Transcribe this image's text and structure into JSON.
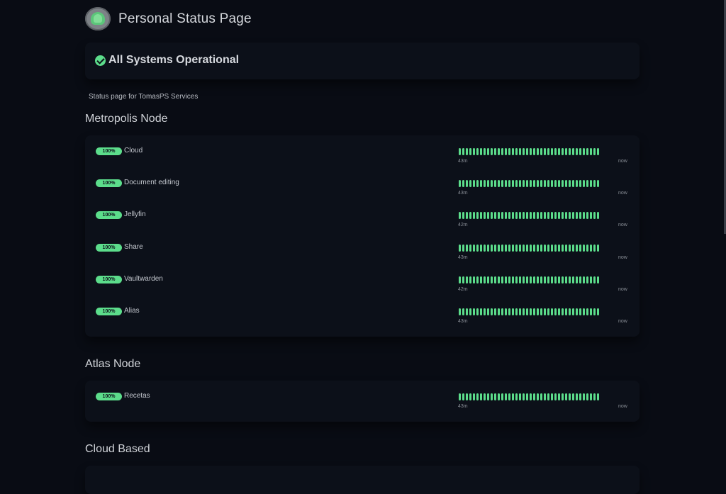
{
  "header": {
    "title": "Personal Status Page",
    "logo_icon": "status-page-logo"
  },
  "overall_status": {
    "text": "All Systems Operational",
    "icon": "check-circle-icon",
    "color": "#5cdd8b"
  },
  "description": "Status page for TomasPS Services",
  "colors": {
    "background": "#090c14",
    "card": "#0c1019",
    "up": "#5cdd8b"
  },
  "groups": [
    {
      "name": "Metropolis Node",
      "monitors": [
        {
          "badge": "100%",
          "name": "Cloud",
          "since": "43m",
          "until": "now",
          "beats_up": 40
        },
        {
          "badge": "100%",
          "name": "Document editing",
          "since": "43m",
          "until": "now",
          "beats_up": 40
        },
        {
          "badge": "100%",
          "name": "Jellyfin",
          "since": "42m",
          "until": "now",
          "beats_up": 40
        },
        {
          "badge": "100%",
          "name": "Share",
          "since": "43m",
          "until": "now",
          "beats_up": 40
        },
        {
          "badge": "100%",
          "name": "Vaultwarden",
          "since": "42m",
          "until": "now",
          "beats_up": 40
        },
        {
          "badge": "100%",
          "name": "Alias",
          "since": "43m",
          "until": "now",
          "beats_up": 40
        }
      ]
    },
    {
      "name": "Atlas Node",
      "monitors": [
        {
          "badge": "100%",
          "name": "Recetas",
          "since": "43m",
          "until": "now",
          "beats_up": 40
        }
      ]
    },
    {
      "name": "Cloud Based",
      "monitors": []
    }
  ]
}
